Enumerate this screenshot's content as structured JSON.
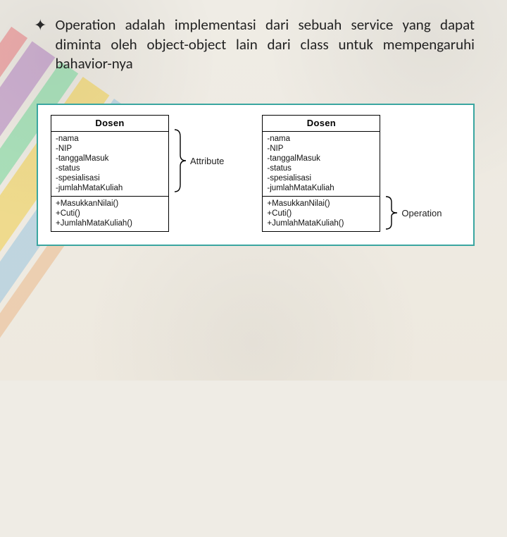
{
  "bullet": {
    "text": "Operation adalah implementasi dari sebuah service yang dapat diminta oleh object-object lain dari class untuk mempengaruhi bahavior-nya"
  },
  "uml": {
    "className": "Dosen",
    "attributes": [
      "-nama",
      "-NIP",
      "-tanggalMasuk",
      "-status",
      "-spesialisasi",
      "-jumlahMataKuliah"
    ],
    "operations": [
      "+MasukkanNilai()",
      "+Cuti()",
      "+JumlahMataKuliah()"
    ]
  },
  "labels": {
    "attribute": "Attribute",
    "operation": "Operation"
  },
  "chart_data": {
    "type": "table",
    "title": "UML Class Diagram: Dosen",
    "className": "Dosen",
    "attributes": [
      {
        "visibility": "-",
        "name": "nama"
      },
      {
        "visibility": "-",
        "name": "NIP"
      },
      {
        "visibility": "-",
        "name": "tanggalMasuk"
      },
      {
        "visibility": "-",
        "name": "status"
      },
      {
        "visibility": "-",
        "name": "spesialisasi"
      },
      {
        "visibility": "-",
        "name": "jumlahMataKuliah"
      }
    ],
    "operations": [
      {
        "visibility": "+",
        "name": "MasukkanNilai()"
      },
      {
        "visibility": "+",
        "name": "Cuti()"
      },
      {
        "visibility": "+",
        "name": "JumlahMataKuliah()"
      }
    ],
    "annotations": [
      "Attribute",
      "Operation"
    ]
  }
}
